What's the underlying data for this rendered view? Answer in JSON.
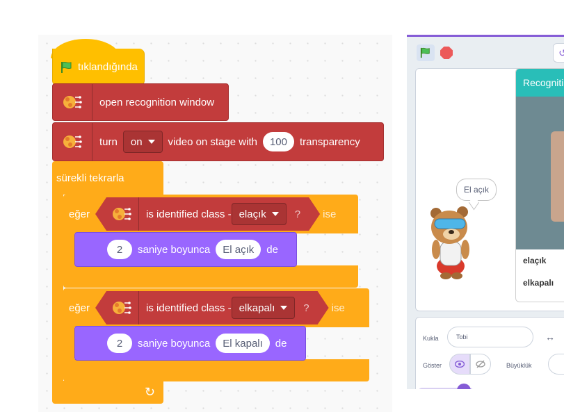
{
  "code": {
    "hat_label": "tıklandığında",
    "open_window_label": "open recognition window",
    "turn_label": "turn",
    "turn_value": "on",
    "video_label": "video on stage with",
    "transparency_value": "100",
    "transparency_label": "transparency",
    "forever_label": "sürekli tekrarla",
    "if1": {
      "if_label": "eğer",
      "cond_label": "is identified class -",
      "class_value": "elaçık",
      "q": "?",
      "then_label": "ise",
      "say_secs": "2",
      "say_mid": "saniye boyunca",
      "say_text": "El açık",
      "say_end": "de"
    },
    "if2": {
      "if_label": "eğer",
      "cond_label": "is identified class -",
      "class_value": "elkapalı",
      "q": "?",
      "then_label": "ise",
      "say_secs": "2",
      "say_mid": "saniye boyunca",
      "say_text": "El kapalı",
      "say_end": "de"
    },
    "loop_arrow": "↻"
  },
  "stage": {
    "bubble_text": "El açık",
    "recognition": {
      "title": "Recogniti",
      "classes": [
        "elaçık",
        "elkapalı"
      ]
    }
  },
  "sprite_info": {
    "sprite_label": "Kukla",
    "sprite_name": "Tobi",
    "x_arrow": "↔",
    "show_label": "Göster",
    "size_label": "Büyüklük"
  },
  "colors": {
    "events": "#ffbf00",
    "control": "#ffab19",
    "extension": "#c23c3c",
    "looks": "#9966ff",
    "recognition_header": "#29beb8"
  }
}
